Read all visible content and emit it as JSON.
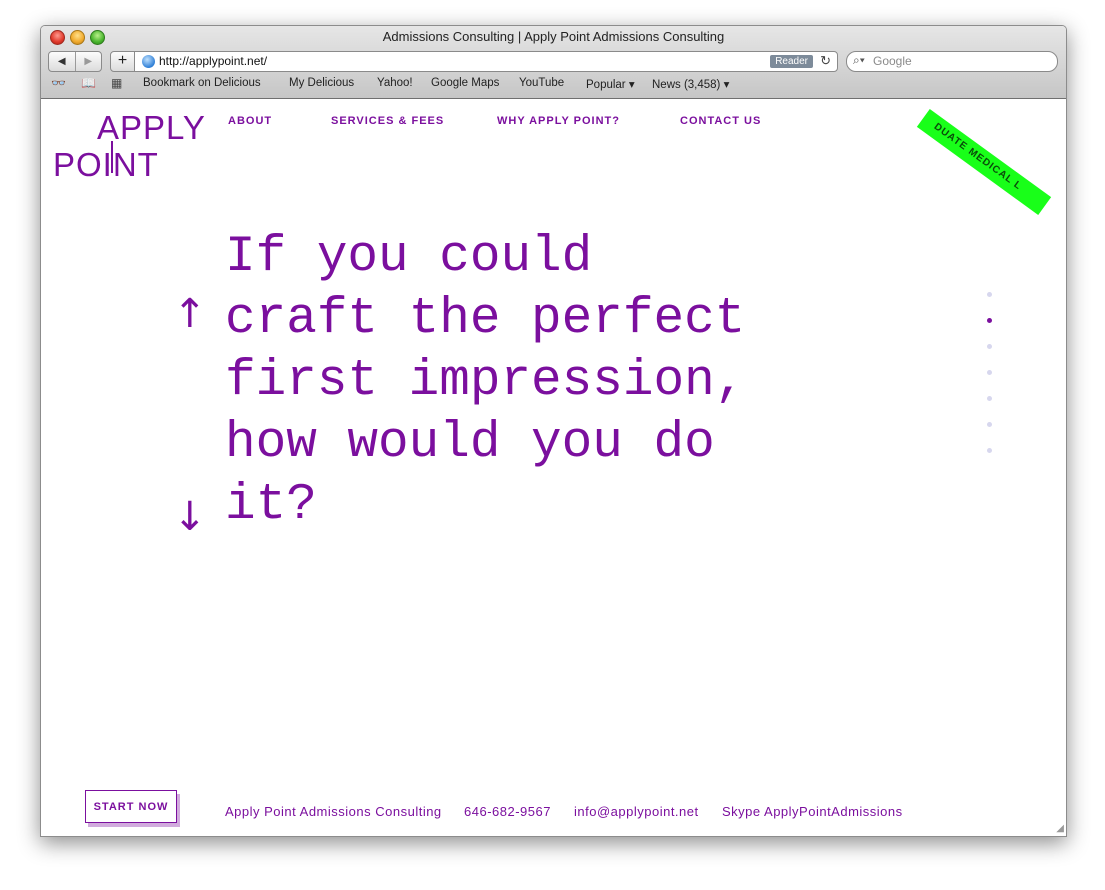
{
  "window": {
    "title": "Admissions Consulting | Apply Point Admissions Consulting"
  },
  "toolbar": {
    "url": "http://applypoint.net/",
    "reader_label": "Reader",
    "search_placeholder": "Google"
  },
  "bookmarks": [
    "Bookmark on Delicious",
    "My Delicious",
    "Yahoo!",
    "Google Maps",
    "YouTube",
    "Popular ▾",
    "News (3,458) ▾"
  ],
  "site": {
    "logo_top": "APPLY",
    "logo_bottom": "POINT",
    "nav": [
      "ABOUT",
      "SERVICES & FEES",
      "WHY APPLY POINT?",
      "CONTACT US"
    ],
    "ribbon_text": "DUATE   MEDICAL   L",
    "headline": "If you could\ncraft the perfect\nfirst impression,\nhow would you do\nit?",
    "arrow_up": "↑",
    "arrow_down": "↓",
    "cta": "START NOW",
    "footer": [
      "Apply Point Admissions Consulting",
      "646-682-9567",
      "info@applypoint.net",
      "Skype ApplyPointAdmissions"
    ],
    "slide_count": 7,
    "active_slide": 2,
    "accent_color": "#7b0f9e",
    "ribbon_color": "#19ff19"
  }
}
